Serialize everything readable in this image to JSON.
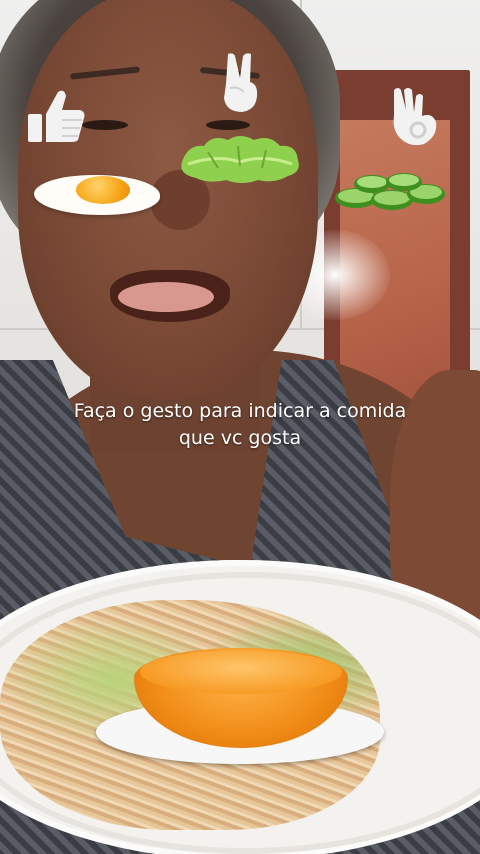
{
  "caption": {
    "line1": "Faça o gesto para indicar a comida",
    "line2": "que vc gosta"
  },
  "gestures": [
    {
      "icon": "thumbs-up-icon",
      "food": "fried-egg"
    },
    {
      "icon": "peace-sign-icon",
      "food": "lettuce"
    },
    {
      "icon": "ok-sign-icon",
      "food": "cucumber-slices"
    }
  ],
  "colors": {
    "caption_text": "#ffffff",
    "gesture_icon": "#f2f2f2",
    "egg_yolk": "#f7a618",
    "lettuce": "#8fd14f",
    "cucumber": "#6fbf3a",
    "orange_dish": "#f08a14"
  }
}
